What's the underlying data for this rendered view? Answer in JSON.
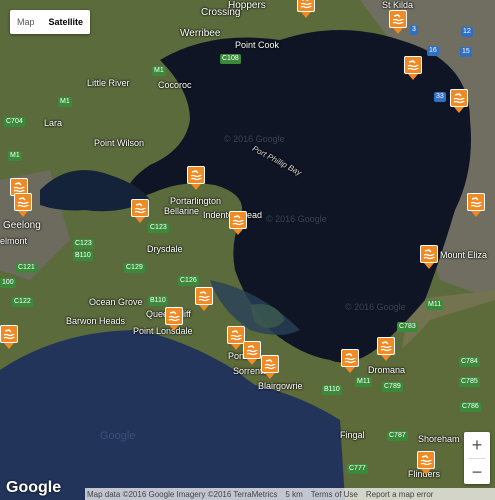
{
  "map_type": {
    "options": [
      "Map",
      "Satellite"
    ],
    "selected": "Satellite"
  },
  "labels": {
    "hoppers": "Hoppers",
    "crossing": "Crossing",
    "werribee": "Werribee",
    "point_cook": "Point Cook",
    "st_kilda": "St Kilda",
    "little_river": "Little River",
    "cocoroc": "Cocoroc",
    "lara": "Lara",
    "point_wilson": "Point Wilson",
    "port_phillip_bay": "Port Phillip Bay",
    "portarlington": "Portarlington",
    "bellarine": "Bellarine",
    "indented_head": "Indented Head",
    "geelong": "Geelong",
    "elmont": "elmont",
    "drysdale": "Drysdale",
    "mount_eliza": "Mount Eliza",
    "ocean_grove": "Ocean Grove",
    "barwon_heads": "Barwon Heads",
    "point_lonsdale": "Point Lonsdale",
    "queenscliff": "Queenscliff",
    "portsea": "Portsea",
    "sorrento": "Sorrento",
    "blairgowrie": "Blairgowrie",
    "dromana": "Dromana",
    "fingal": "Fingal",
    "shoreham": "Shoreham",
    "flinders": "Flinders",
    "watermark_1": "© 2016 Google",
    "watermark_2": "© 2016 Google",
    "watermark_3": "© 2016 Google",
    "google_watermark": "Google"
  },
  "roads": {
    "m1a": "M1",
    "c108": "C108",
    "m1b": "M1",
    "c704": "C704",
    "m1c": "M1",
    "c123a": "C123",
    "c123b": "C123",
    "b110a": "B110",
    "c121": "C121",
    "c129": "C129",
    "c126": "C126",
    "b100": "100",
    "c122": "C122",
    "b110b": "B110",
    "b110c": "B110",
    "m11a": "M11",
    "c789": "C789",
    "c783": "C783",
    "c784": "C784",
    "c785": "C785",
    "c786": "C786",
    "c787": "C787",
    "c777": "C777",
    "m11b": "M11",
    "r3": "3",
    "r16": "16",
    "r33": "33",
    "r12": "12",
    "r15": "15"
  },
  "controls": {
    "zoom_in": "+",
    "zoom_out": "−"
  },
  "attribution": {
    "map_data": "Map data ©2016 Google Imagery ©2016 TerraMetrics",
    "scale": "5 km",
    "terms": "Terms of Use",
    "report": "Report a map error"
  },
  "logo": "Google",
  "colors": {
    "marker": "#f08a24",
    "land": "#5b6b3c",
    "bay": "#0f1524",
    "ocean": "#22345a"
  }
}
